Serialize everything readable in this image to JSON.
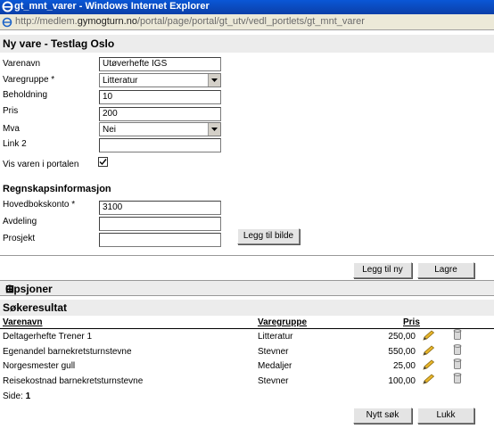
{
  "window": {
    "title": "gt_mnt_varer - Windows Internet Explorer",
    "url_prefix": "http://medlem.",
    "url_host": "gymogturn.no",
    "url_path": "/portal/page/portal/gt_utv/vedl_portlets/gt_mnt_varer"
  },
  "form": {
    "heading": "Ny vare - Testlag Oslo",
    "fields": {
      "varenavn_label": "Varenavn",
      "varenavn_value": "Utøverhefte IGS",
      "varegruppe_label": "Varegruppe *",
      "varegruppe_value": "Litteratur",
      "beholdning_label": "Beholdning",
      "beholdning_value": "10",
      "pris_label": "Pris",
      "pris_value": "200",
      "mva_label": "Mva",
      "mva_value": "Nei",
      "link2_label": "Link 2",
      "link2_value": "",
      "vis_label": "Vis varen i portalen",
      "vis_checked": true
    },
    "regnskap_heading": "Regnskapsinformasjon",
    "regnskap": {
      "hovedbok_label": "Hovedbokskonto *",
      "hovedbok_value": "3100",
      "avdeling_label": "Avdeling",
      "avdeling_value": "",
      "prosjekt_label": "Prosjekt",
      "prosjekt_value": ""
    },
    "legg_til_bilde": "Legg til bilde",
    "legg_til_ny": "Legg til ny",
    "lagre": "Lagre"
  },
  "opsjoner": {
    "toggle": "⊞",
    "label": "Opsjoner"
  },
  "results": {
    "heading": "Søkeresultat",
    "columns": {
      "varenavn": "Varenavn",
      "varegruppe": "Varegruppe",
      "pris": "Pris"
    },
    "rows": [
      {
        "varenavn": "Deltagerhefte Trener 1",
        "varegruppe": "Litteratur",
        "pris": "250,00"
      },
      {
        "varenavn": "Egenandel barnekretsturnstevne",
        "varegruppe": "Stevner",
        "pris": "550,00"
      },
      {
        "varenavn": "Norgesmester gull",
        "varegruppe": "Medaljer",
        "pris": "25,00"
      },
      {
        "varenavn": "Reisekostnad barnekretsturnstevne",
        "varegruppe": "Stevner",
        "pris": "100,00"
      }
    ],
    "side_label": "Side:",
    "side_value": "1",
    "nytt_sok": "Nytt søk",
    "lukk": "Lukk"
  },
  "icons": {
    "edit": "pencil-icon",
    "delete": "trash-icon"
  }
}
